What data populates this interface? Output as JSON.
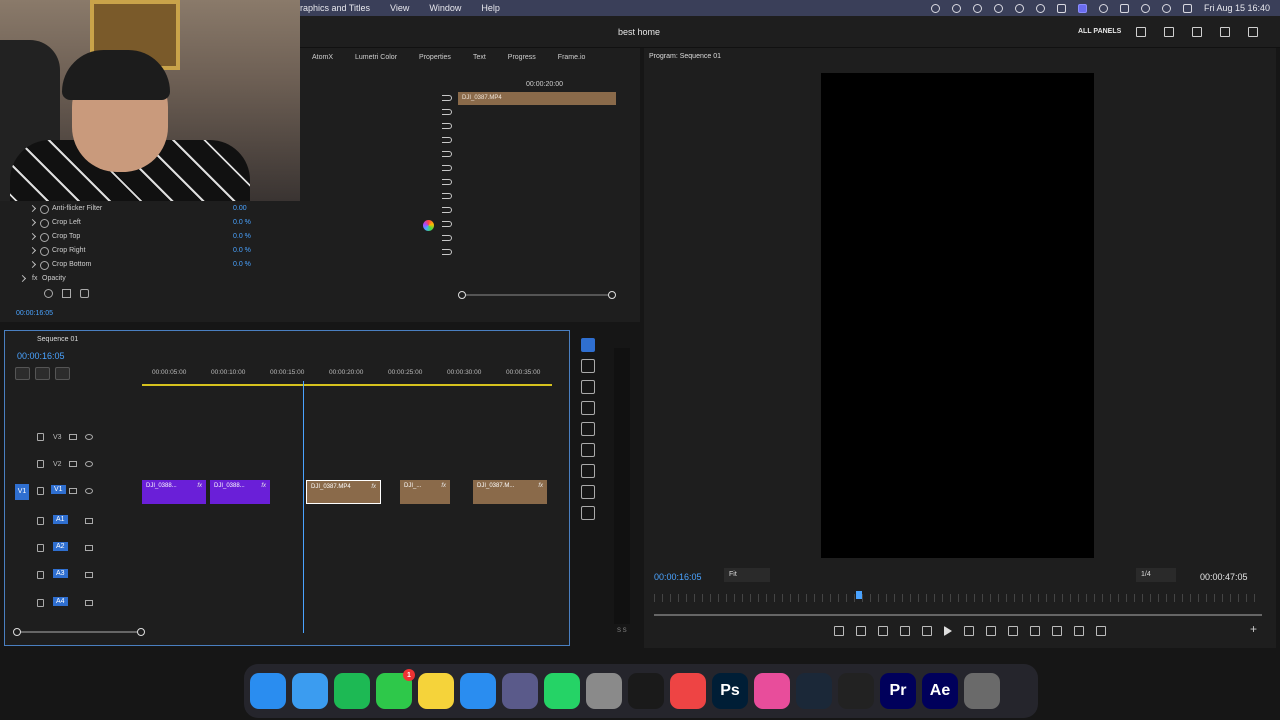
{
  "menubar": {
    "menus": [
      "raphics and Titles",
      "View",
      "Window",
      "Help"
    ],
    "datetime": "Fri Aug 15  16:40"
  },
  "app": {
    "project_title": "best home",
    "all_panels": "ALL PANELS"
  },
  "effect_panel": {
    "tabs": [
      "AtomX",
      "Lumetri Color",
      "Properties",
      "Text",
      "Progress",
      "Frame.io"
    ],
    "timeline_tc": "00:00:20:00",
    "clip_name": "DJI_0387.MP4",
    "rows": [
      {
        "label": "Anti-flicker Filter",
        "value": "0.00"
      },
      {
        "label": "Crop Left",
        "value": "0.0 %"
      },
      {
        "label": "Crop Top",
        "value": "0.0 %"
      },
      {
        "label": "Crop Right",
        "value": "0.0 %"
      },
      {
        "label": "Crop Bottom",
        "value": "0.0 %"
      },
      {
        "label": "Opacity",
        "value": ""
      }
    ],
    "bottom_tc": "00:00:16:05"
  },
  "timeline": {
    "sequence_name": "Sequence 01",
    "timecode": "00:00:16:05",
    "ruler": [
      "00:00:05:00",
      "00:00:10:00",
      "00:00:15:00",
      "00:00:20:00",
      "00:00:25:00",
      "00:00:30:00",
      "00:00:35:00"
    ],
    "tracks": [
      "V3",
      "V2",
      "V1",
      "A1",
      "A2",
      "A3",
      "A4"
    ],
    "clips": [
      {
        "name": "DJI_0388..."
      },
      {
        "name": "DJI_0388..."
      },
      {
        "name": "DJI_0387.MP4"
      },
      {
        "name": "DJI_..."
      },
      {
        "name": "DJI_0387.M..."
      }
    ]
  },
  "program": {
    "title": "Program: Sequence 01",
    "current_tc": "00:00:16:05",
    "fit": "Fit",
    "resolution": "1/4",
    "duration_tc": "00:00:47:05"
  },
  "meter_label": "S S",
  "dock": {
    "apps": [
      {
        "icon": "finder-icon",
        "label": "",
        "color": "#2a8df0"
      },
      {
        "icon": "safari-icon",
        "label": "",
        "color": "#3b9cf0"
      },
      {
        "icon": "spotify-icon",
        "label": "",
        "color": "#1db954"
      },
      {
        "icon": "facetime-icon",
        "label": "",
        "color": "#2ec84a",
        "badge": "1"
      },
      {
        "icon": "notes-icon",
        "label": "",
        "color": "#f5d33a"
      },
      {
        "icon": "appstore-icon",
        "label": "",
        "color": "#2a8df0"
      },
      {
        "icon": "launchpad-icon",
        "label": "",
        "color": "#5a5a8a"
      },
      {
        "icon": "whatsapp-icon",
        "label": "",
        "color": "#25d366"
      },
      {
        "icon": "settings-icon",
        "label": "",
        "color": "#8a8a8a"
      },
      {
        "icon": "activity-icon",
        "label": "",
        "color": "#1a1a1a"
      },
      {
        "icon": "app-icon",
        "label": "",
        "color": "#e44"
      },
      {
        "icon": "photoshop-icon",
        "label": "Ps",
        "color": "#001e36"
      },
      {
        "icon": "firefox-icon",
        "label": "",
        "color": "#e84d9b"
      },
      {
        "icon": "steam-icon",
        "label": "",
        "color": "#1b2838"
      },
      {
        "icon": "obs-icon",
        "label": "",
        "color": "#222"
      },
      {
        "icon": "premiere-icon",
        "label": "Pr",
        "color": "#00005b"
      },
      {
        "icon": "aftereffects-icon",
        "label": "Ae",
        "color": "#00005b"
      },
      {
        "icon": "trash-icon",
        "label": "",
        "color": "#6a6a6a"
      }
    ]
  }
}
